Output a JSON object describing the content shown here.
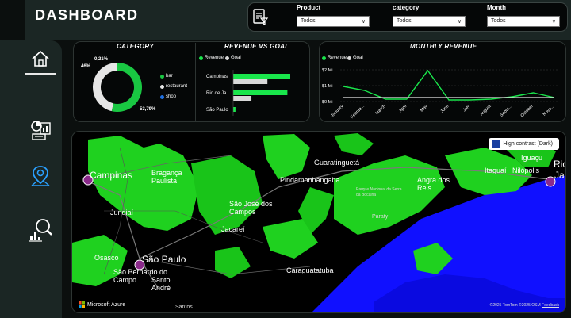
{
  "header": {
    "title": "DASHBOARD"
  },
  "filters": [
    {
      "label": "Product",
      "value": "Todos"
    },
    {
      "label": "category",
      "value": "Todos"
    },
    {
      "label": "Month",
      "value": "Todos"
    }
  ],
  "sidebar": {
    "items": [
      "home-icon",
      "report-icon",
      "map-pin-icon",
      "analytics-icon"
    ]
  },
  "category_card": {
    "title": "CATEGORY",
    "pct_small": "0,21%",
    "pct_left": "46%",
    "pct_right": "53,79%",
    "legend": [
      "bar",
      "restaurant",
      "shop"
    ],
    "colors": {
      "bar": "#19c742",
      "restaurant": "#e6e6e6",
      "shop": "#1f6fe0"
    }
  },
  "revenue_goal": {
    "title": "REVENUE VS GOAL",
    "legend": [
      "Revenue",
      "Goal"
    ]
  },
  "monthly": {
    "title": "MONTHLY REVENUE",
    "legend": [
      "Revenue",
      "Goal"
    ]
  },
  "chart_data": [
    {
      "type": "pie",
      "title": "CATEGORY",
      "categories": [
        "bar",
        "restaurant",
        "shop"
      ],
      "values": [
        53.79,
        46.0,
        0.21
      ]
    },
    {
      "type": "bar",
      "title": "REVENUE VS GOAL",
      "categories": [
        "Campinas",
        "Rio de Ja...",
        "São Paulo"
      ],
      "series": [
        {
          "name": "Revenue",
          "values": [
            100,
            95,
            4
          ]
        },
        {
          "name": "Goal",
          "values": [
            60,
            32,
            0
          ]
        }
      ],
      "xlim": [
        0,
        100
      ]
    },
    {
      "type": "line",
      "title": "MONTHLY REVENUE",
      "categories": [
        "January",
        "Februa...",
        "March",
        "April",
        "May",
        "June",
        "July",
        "August",
        "Septe...",
        "October",
        "Nove..."
      ],
      "yticks": [
        "$0 Mi",
        "$1 Mi",
        "$2 Mi"
      ],
      "ylim": [
        0,
        2.2
      ],
      "series": [
        {
          "name": "Revenue",
          "values": [
            0.95,
            0.7,
            0.15,
            0.15,
            1.95,
            0.1,
            0.1,
            0.15,
            0.3,
            0.55,
            0.25
          ]
        },
        {
          "name": "Goal",
          "values": [
            0.25,
            0.25,
            0.25,
            0.25,
            0.25,
            0.25,
            0.25,
            0.25,
            0.25,
            0.25,
            0.25
          ]
        }
      ]
    }
  ],
  "map": {
    "control_label": "High contrast (Dark)",
    "brand": "Microsoft Azure",
    "copyright": "©2025 TomTom ©2025 OSM",
    "feedback": "Feedback",
    "cities_big": [
      {
        "name": "Campinas"
      },
      {
        "name": "São Paulo"
      }
    ],
    "cities": [
      {
        "name": "Bragança Paulista"
      },
      {
        "name": "Guaratinguetá"
      },
      {
        "name": "Pindamonhangaba"
      },
      {
        "name": "São José dos Campos"
      },
      {
        "name": "Jundiaí"
      },
      {
        "name": "Jacareí"
      },
      {
        "name": "Osasco"
      },
      {
        "name": "São Bernardo do Campo"
      },
      {
        "name": "Santo André"
      },
      {
        "name": "Caraguatatuba"
      },
      {
        "name": "Angra dos Reis"
      },
      {
        "name": "Itaguaí"
      },
      {
        "name": "Nilópolis"
      },
      {
        "name": "Iguaçu"
      },
      {
        "name": "Rio"
      },
      {
        "name": "Jan"
      },
      {
        "name": "Paraty"
      },
      {
        "name": "Parque Nacional da Serra da Bocaina"
      },
      {
        "name": "Santos"
      }
    ],
    "markers": [
      "campinas",
      "sao-paulo",
      "rio"
    ]
  }
}
